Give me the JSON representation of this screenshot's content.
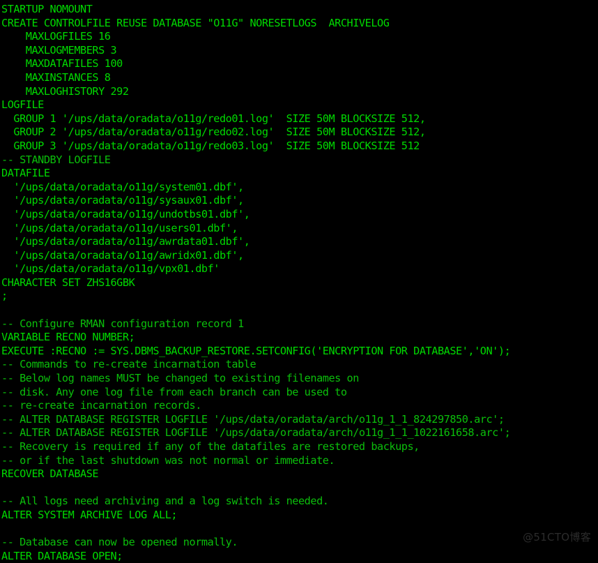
{
  "terminal": {
    "background_color": "#000000",
    "text_color": "#00d900",
    "comment_color": "#0bbf0b",
    "lines": [
      {
        "text": "STARTUP NOMOUNT",
        "kind": "code"
      },
      {
        "text": "CREATE CONTROLFILE REUSE DATABASE \"O11G\" NORESETLOGS  ARCHIVELOG",
        "kind": "code"
      },
      {
        "text": "    MAXLOGFILES 16",
        "kind": "code"
      },
      {
        "text": "    MAXLOGMEMBERS 3",
        "kind": "code"
      },
      {
        "text": "    MAXDATAFILES 100",
        "kind": "code"
      },
      {
        "text": "    MAXINSTANCES 8",
        "kind": "code"
      },
      {
        "text": "    MAXLOGHISTORY 292",
        "kind": "code"
      },
      {
        "text": "LOGFILE",
        "kind": "code"
      },
      {
        "text": "  GROUP 1 '/ups/data/oradata/o11g/redo01.log'  SIZE 50M BLOCKSIZE 512,",
        "kind": "code"
      },
      {
        "text": "  GROUP 2 '/ups/data/oradata/o11g/redo02.log'  SIZE 50M BLOCKSIZE 512,",
        "kind": "code"
      },
      {
        "text": "  GROUP 3 '/ups/data/oradata/o11g/redo03.log'  SIZE 50M BLOCKSIZE 512",
        "kind": "code"
      },
      {
        "text": "-- STANDBY LOGFILE",
        "kind": "comment"
      },
      {
        "text": "DATAFILE",
        "kind": "code"
      },
      {
        "text": "  '/ups/data/oradata/o11g/system01.dbf',",
        "kind": "code"
      },
      {
        "text": "  '/ups/data/oradata/o11g/sysaux01.dbf',",
        "kind": "code"
      },
      {
        "text": "  '/ups/data/oradata/o11g/undotbs01.dbf',",
        "kind": "code"
      },
      {
        "text": "  '/ups/data/oradata/o11g/users01.dbf',",
        "kind": "code"
      },
      {
        "text": "  '/ups/data/oradata/o11g/awrdata01.dbf',",
        "kind": "code"
      },
      {
        "text": "  '/ups/data/oradata/o11g/awridx01.dbf',",
        "kind": "code"
      },
      {
        "text": "  '/ups/data/oradata/o11g/vpx01.dbf'",
        "kind": "code"
      },
      {
        "text": "CHARACTER SET ZHS16GBK",
        "kind": "code"
      },
      {
        "text": ";",
        "kind": "code"
      },
      {
        "text": "",
        "kind": "blank"
      },
      {
        "text": "-- Configure RMAN configuration record 1",
        "kind": "comment"
      },
      {
        "text": "VARIABLE RECNO NUMBER;",
        "kind": "code"
      },
      {
        "text": "EXECUTE :RECNO := SYS.DBMS_BACKUP_RESTORE.SETCONFIG('ENCRYPTION FOR DATABASE','ON');",
        "kind": "code"
      },
      {
        "text": "-- Commands to re-create incarnation table",
        "kind": "comment"
      },
      {
        "text": "-- Below log names MUST be changed to existing filenames on",
        "kind": "comment"
      },
      {
        "text": "-- disk. Any one log file from each branch can be used to",
        "kind": "comment"
      },
      {
        "text": "-- re-create incarnation records.",
        "kind": "comment"
      },
      {
        "text": "-- ALTER DATABASE REGISTER LOGFILE '/ups/data/oradata/arch/o11g_1_1_824297850.arc';",
        "kind": "comment"
      },
      {
        "text": "-- ALTER DATABASE REGISTER LOGFILE '/ups/data/oradata/arch/o11g_1_1_1022161658.arc';",
        "kind": "comment"
      },
      {
        "text": "-- Recovery is required if any of the datafiles are restored backups,",
        "kind": "comment"
      },
      {
        "text": "-- or if the last shutdown was not normal or immediate.",
        "kind": "comment"
      },
      {
        "text": "RECOVER DATABASE",
        "kind": "code"
      },
      {
        "text": "",
        "kind": "blank"
      },
      {
        "text": "-- All logs need archiving and a log switch is needed.",
        "kind": "comment"
      },
      {
        "text": "ALTER SYSTEM ARCHIVE LOG ALL;",
        "kind": "code"
      },
      {
        "text": "",
        "kind": "blank"
      },
      {
        "text": "-- Database can now be opened normally.",
        "kind": "comment"
      },
      {
        "text": "ALTER DATABASE OPEN;",
        "kind": "code"
      }
    ]
  },
  "watermark": {
    "text": "@51CTO博客"
  }
}
